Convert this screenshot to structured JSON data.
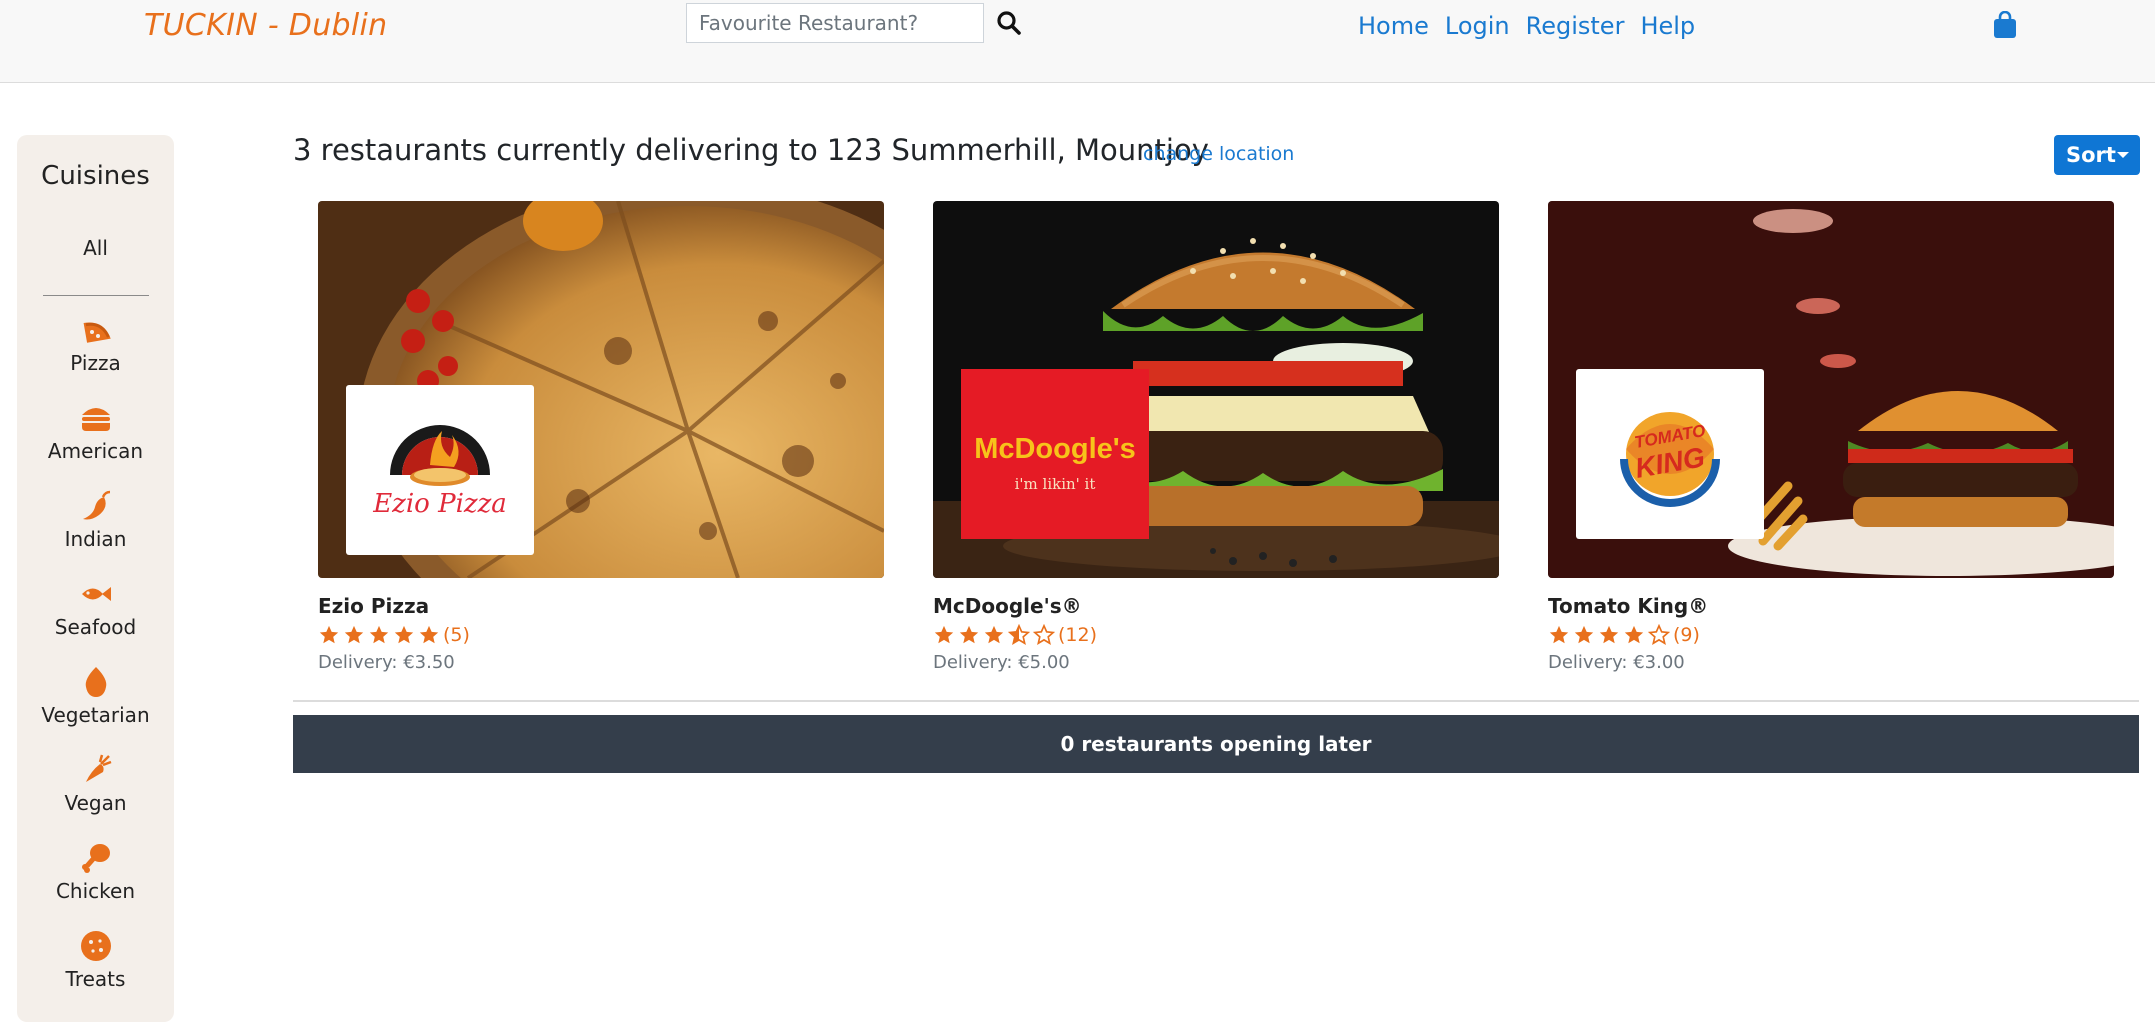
{
  "navbar": {
    "brand": "TUCKIN - Dublin",
    "search_placeholder": "Favourite Restaurant?",
    "links": [
      "Home",
      "Login",
      "Register",
      "Help"
    ]
  },
  "sidebar": {
    "title": "Cuisines",
    "all_label": "All",
    "items": [
      {
        "label": "Pizza",
        "icon": "pizza-icon"
      },
      {
        "label": "American",
        "icon": "burger-icon"
      },
      {
        "label": "Indian",
        "icon": "chili-pepper-icon"
      },
      {
        "label": "Seafood",
        "icon": "fish-icon"
      },
      {
        "label": "Vegetarian",
        "icon": "egg-icon"
      },
      {
        "label": "Vegan",
        "icon": "carrot-icon"
      },
      {
        "label": "Chicken",
        "icon": "drumstick-icon"
      },
      {
        "label": "Treats",
        "icon": "cookie-icon"
      }
    ]
  },
  "main": {
    "headline": "3 restaurants currently delivering to 123 Summerhill, Mountjoy",
    "change_location": "change location",
    "sort_label": "Sort",
    "restaurants": [
      {
        "name": "Ezio Pizza",
        "rating": 5,
        "rating_count": "(5)",
        "delivery": "Delivery: €3.50",
        "logo_text": "Ezio Pizza"
      },
      {
        "name": "McDoogle's®",
        "rating": 3.5,
        "rating_count": "(12)",
        "delivery": "Delivery: €5.00",
        "logo_text": "McDoogle's",
        "logo_tagline": "i'm likin' it"
      },
      {
        "name": "Tomato King®",
        "rating": 4,
        "rating_count": "(9)",
        "delivery": "Delivery: €3.00",
        "logo_text_top": "TOMATO",
        "logo_text_bottom": "KING"
      }
    ],
    "opening_later": "0 restaurants opening later"
  },
  "colors": {
    "brand": "#e8701c",
    "link": "#1a7ad0",
    "sort_button": "#0f76d4",
    "sidebar_bg": "#f4efea",
    "bar_bg": "#343e4b"
  }
}
